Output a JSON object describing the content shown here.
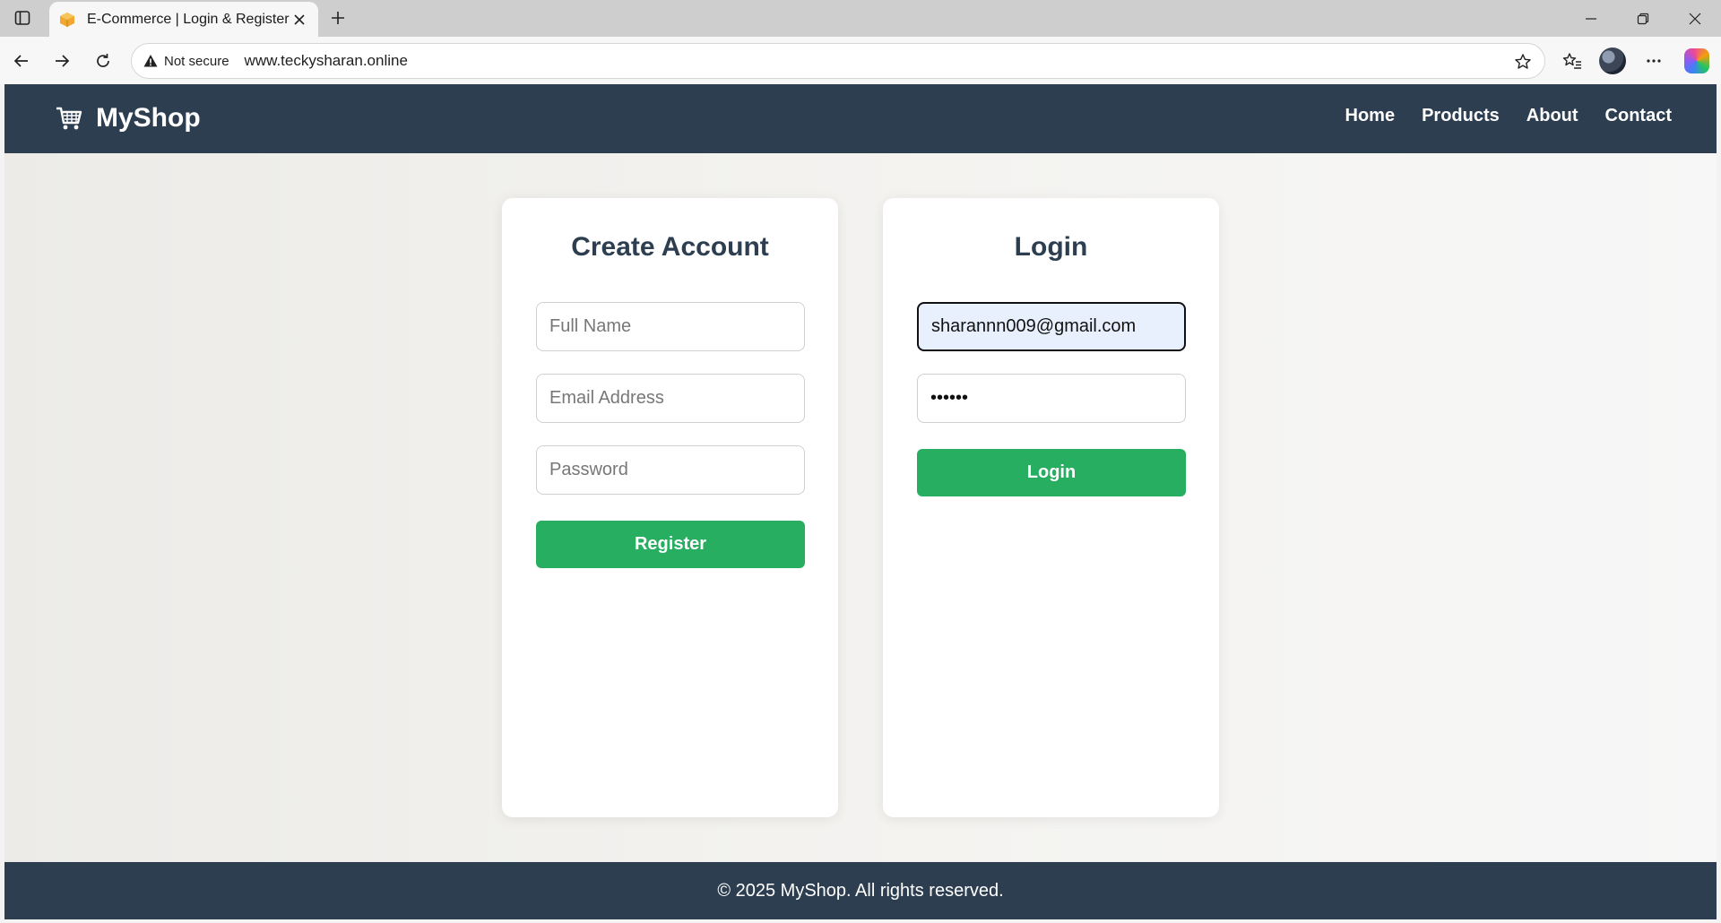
{
  "browser": {
    "tab_title": "E-Commerce | Login & Register",
    "security_label": "Not secure",
    "url": "www.teckysharan.online"
  },
  "site": {
    "brand": "MyShop",
    "nav": [
      "Home",
      "Products",
      "About",
      "Contact"
    ],
    "footer": "© 2025 MyShop. All rights reserved."
  },
  "register": {
    "title": "Create Account",
    "name_placeholder": "Full Name",
    "email_placeholder": "Email Address",
    "password_placeholder": "Password",
    "button": "Register"
  },
  "login": {
    "title": "Login",
    "email_value": "sharannn009@gmail.com",
    "password_value": "••••••",
    "button": "Login"
  },
  "colors": {
    "header_bg": "#2c3e50",
    "button_green": "#27ae60",
    "heading": "#2c3e50"
  },
  "icons": [
    "tab-actions-icon",
    "package-icon",
    "close-icon",
    "plus-icon",
    "minimize-icon",
    "restore-icon",
    "back-icon",
    "forward-icon",
    "refresh-icon",
    "warning-icon",
    "star-icon",
    "favorites-icon",
    "more-icon",
    "copilot-icon",
    "cart-icon"
  ]
}
